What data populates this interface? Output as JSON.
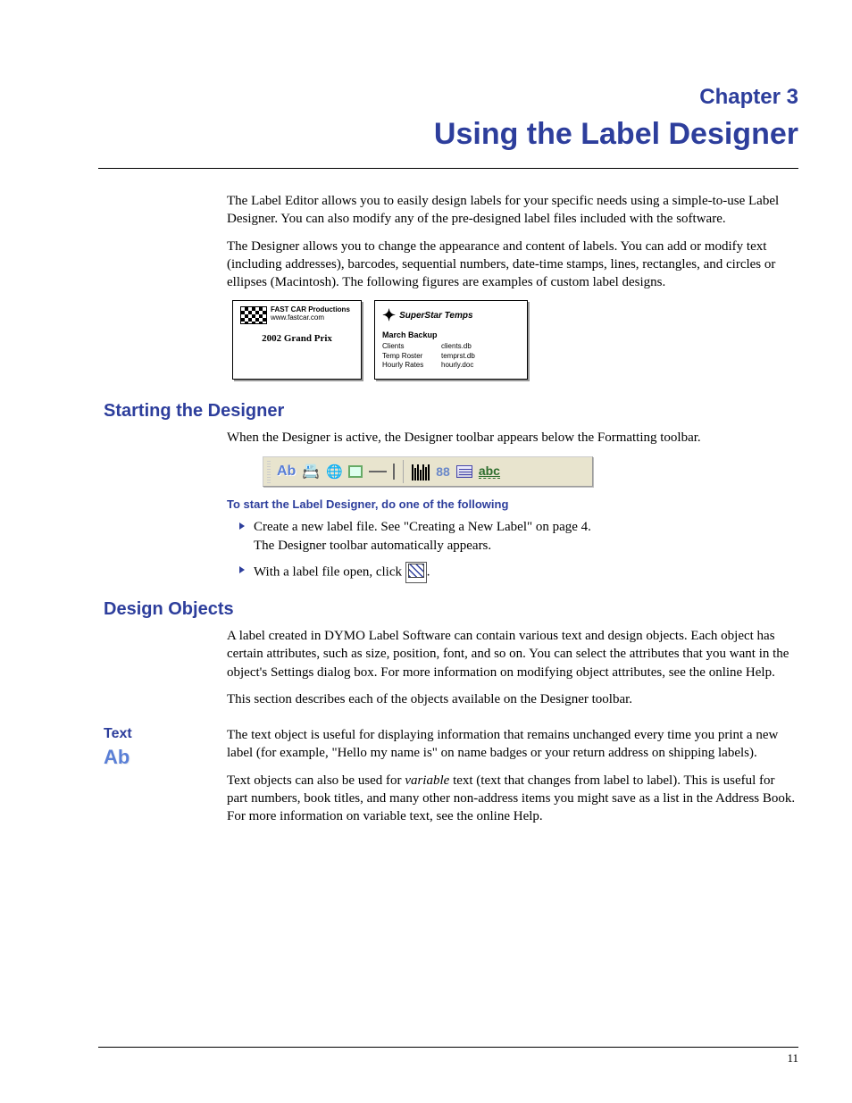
{
  "chapter": {
    "label": "Chapter 3",
    "title": "Using the Label Designer"
  },
  "intro": {
    "p1": "The Label Editor allows you to easily design labels for your specific needs using a simple-to-use Label Designer. You can also modify any of the pre-designed label files included with the software.",
    "p2": "The Designer allows you to change the appearance and content of labels. You can add or modify text (including addresses), barcodes, sequential numbers, date-time stamps, lines, rectangles, and circles or ellipses (Macintosh). The following figures are examples of custom label designs."
  },
  "example1": {
    "company": "FAST CAR Productions",
    "url": "www.fastcar.com",
    "event": "2002 Grand Prix"
  },
  "example2": {
    "company": "SuperStar Temps",
    "subtitle": "March Backup",
    "rows": [
      {
        "c1": "Clients",
        "c2": "clients.db"
      },
      {
        "c1": "Temp Roster",
        "c2": "temprst.db"
      },
      {
        "c1": "Hourly Rates",
        "c2": "hourly.doc"
      }
    ]
  },
  "starting": {
    "heading": "Starting the Designer",
    "p1": "When the Designer is active, the Designer toolbar appears below the Formatting toolbar.",
    "instr_head": "To start the Label Designer, do one of the following",
    "b1_line1": "Create a new label file. See \"Creating a New Label\" on page 4.",
    "b1_line2": "The Designer toolbar automatically appears.",
    "b2_pre": "With a label file open, click ",
    "b2_post": "."
  },
  "toolbar_icons": {
    "ab": "Ab",
    "counter": "88",
    "curved": "abc"
  },
  "design": {
    "heading": "Design Objects",
    "p1": "A label created in DYMO Label Software can contain various text and design objects. Each object has certain attributes, such as size, position, font, and so on. You can select the attributes that you want in the object's Settings dialog box. For more information on modifying object attributes, see the online Help.",
    "p2": "This section describes each of the objects available on the Designer toolbar."
  },
  "text_obj": {
    "side_head": "Text",
    "side_icon": "Ab",
    "p1": "The text object is useful for displaying information that remains unchanged every time you print a new label (for example, \"Hello my name is\" on name badges or your return address on shipping labels).",
    "p2_pre": "Text objects can also be used for ",
    "p2_em": "variable",
    "p2_post": " text (text that changes from label to label). This is useful for part numbers, book titles, and many other non-address items you might save as a list in the Address Book. For more information on variable text, see the online Help."
  },
  "page_number": "11"
}
